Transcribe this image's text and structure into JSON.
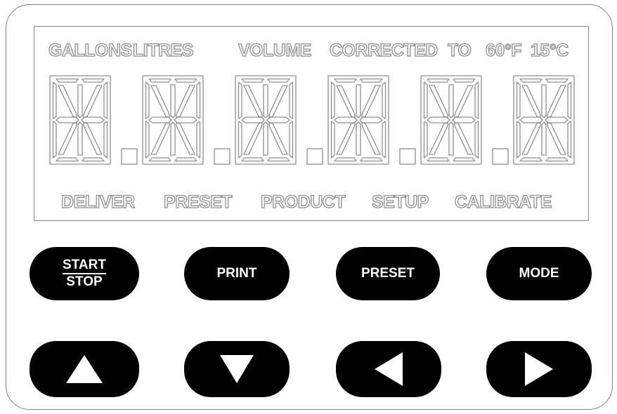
{
  "display": {
    "top_labels": {
      "gallons": "GALLONS",
      "litres": "LITRES",
      "volume": "VOLUME",
      "corrected": "CORRECTED",
      "to": "TO",
      "temp_f": "60°F",
      "temp_c": "15°C"
    },
    "bottom_labels": {
      "deliver": "DELIVER",
      "preset": "PRESET",
      "product": "PRODUCT",
      "setup": "SETUP",
      "calibrate": "CALIBRATE"
    },
    "digit_count": 6,
    "decimal_point_count": 5
  },
  "keys": {
    "start": "START",
    "stop": "STOP",
    "print": "PRINT",
    "preset": "PRESET",
    "mode": "MODE"
  },
  "arrow_icons": [
    "up-arrow-icon",
    "down-arrow-icon",
    "left-arrow-icon",
    "right-arrow-icon"
  ],
  "colors": {
    "key_fill": "#000000",
    "key_text": "#ffffff",
    "lcd_outline": "#8f8f8f"
  }
}
